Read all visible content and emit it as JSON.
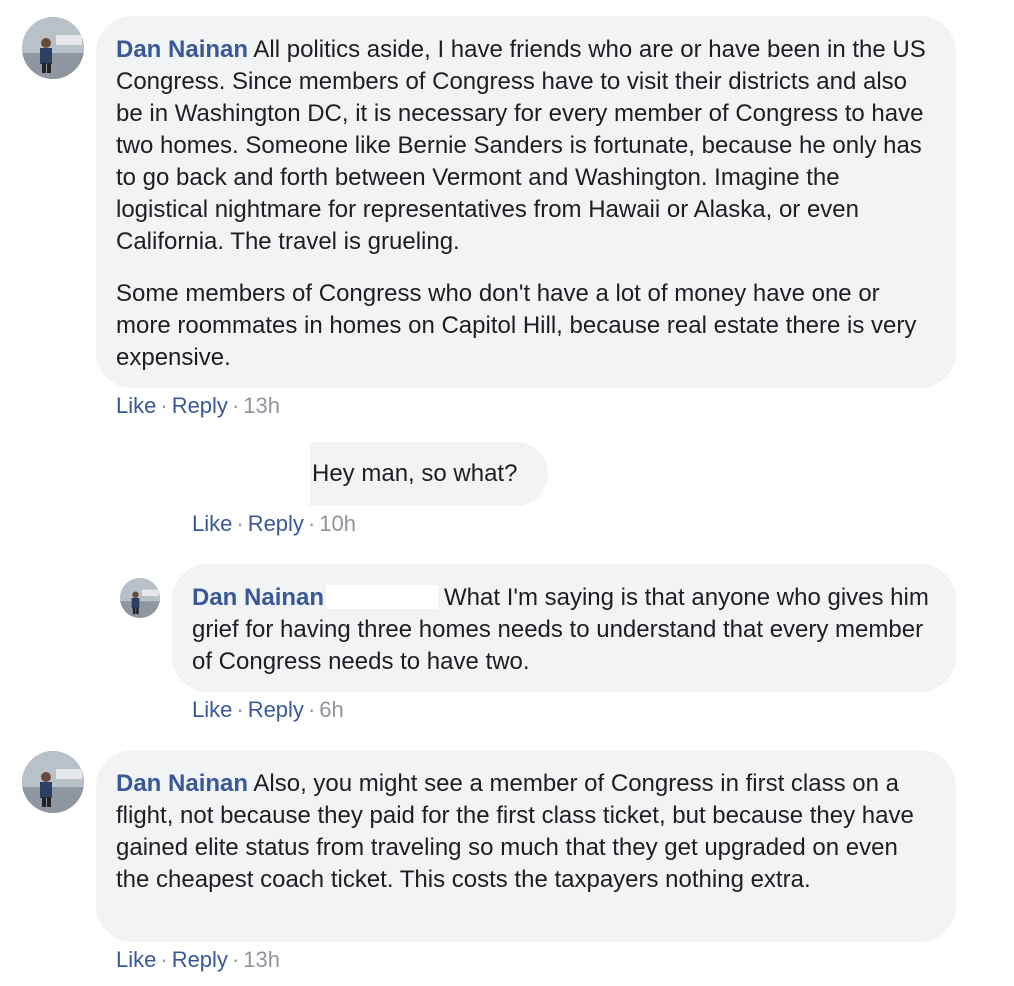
{
  "comments": [
    {
      "author": "Dan Nainan",
      "paragraph1": "All politics aside, I have friends who are or have been in the US Congress. Since members of Congress have to visit their districts and also be in Washington DC, it is necessary for every member of Congress to have two homes. Someone like Bernie Sanders is fortunate, because he only has to go back and forth between Vermont and Washington. Imagine the logistical nightmare for representatives from Hawaii or Alaska, or even California. The travel is grueling.",
      "paragraph2": "Some members of Congress who don't have a lot of money have one or more roommates in homes on Capitol Hill, because real estate there is very expensive.",
      "like": "Like",
      "reply": "Reply",
      "time": "13h"
    },
    {
      "text": "Hey man, so what?",
      "like": "Like",
      "reply": "Reply",
      "time": "10h"
    },
    {
      "author": "Dan Nainan",
      "text": "What I'm saying is that anyone who gives him grief for having three homes needs to understand that every member of Congress needs to have two.",
      "like": "Like",
      "reply": "Reply",
      "time": "6h"
    },
    {
      "author": "Dan Nainan",
      "text": "Also, you might see a member of Congress in first class on a flight, not because they paid for the first class ticket, but because they have gained elite status from traveling so much that they get upgraded on even the cheapest coach ticket. This costs the taxpayers nothing extra.",
      "like": "Like",
      "reply": "Reply",
      "time": "13h"
    }
  ],
  "separator": "·",
  "colors": {
    "link": "#385898",
    "bubble": "#f2f3f5",
    "meta": "#90949c"
  },
  "icons": {
    "avatar": "profile-photo-avatar"
  }
}
